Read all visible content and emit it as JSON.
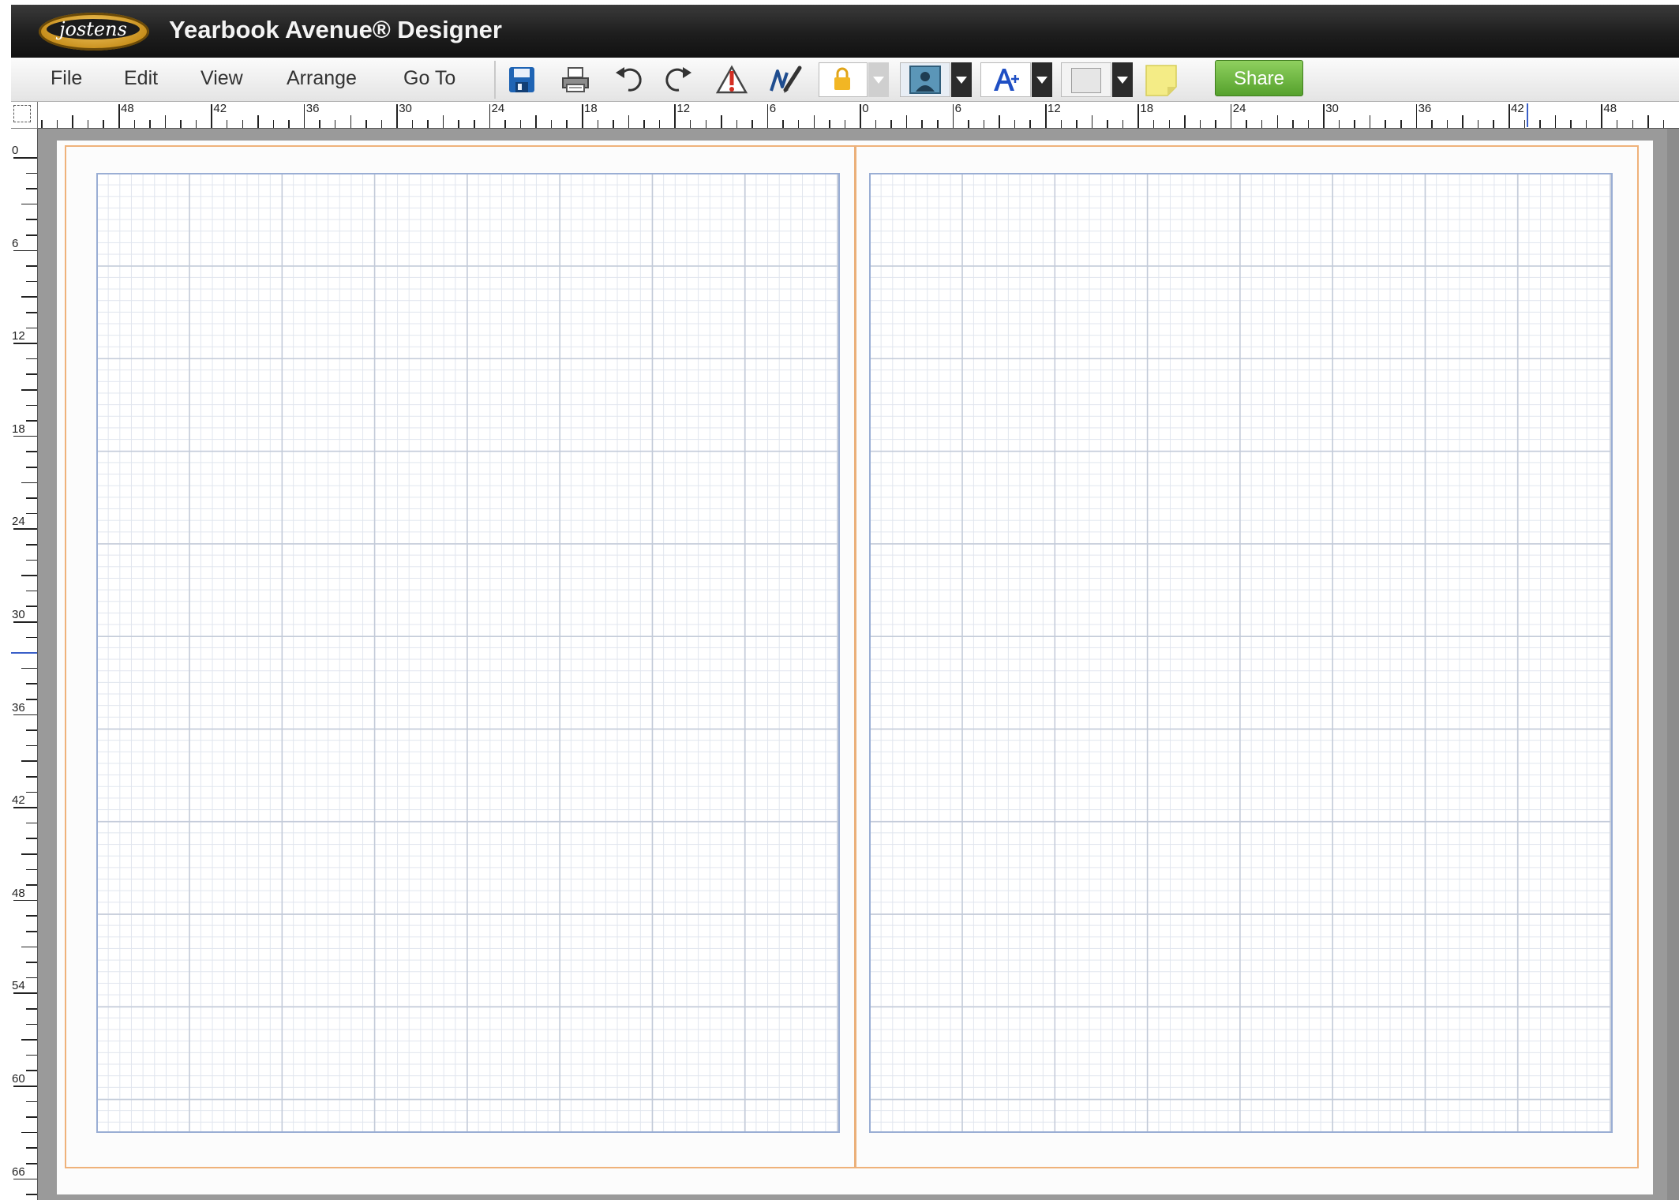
{
  "app": {
    "brand": "jostens",
    "title": "Yearbook Avenue® Designer"
  },
  "menu": [
    {
      "id": "file",
      "label": "File"
    },
    {
      "id": "edit",
      "label": "Edit"
    },
    {
      "id": "view",
      "label": "View"
    },
    {
      "id": "arrange",
      "label": "Arrange"
    },
    {
      "id": "goto",
      "label": "Go To"
    }
  ],
  "toolbar": {
    "tools": [
      {
        "id": "save",
        "icon": "save-icon"
      },
      {
        "id": "print",
        "icon": "print-icon"
      },
      {
        "id": "undo",
        "icon": "undo-icon"
      },
      {
        "id": "redo",
        "icon": "redo-icon"
      },
      {
        "id": "alert",
        "icon": "warning-icon"
      },
      {
        "id": "signature",
        "icon": "signature-pen-icon"
      },
      {
        "id": "lock",
        "icon": "lock-icon"
      },
      {
        "id": "image",
        "icon": "image-frame-icon"
      },
      {
        "id": "text",
        "icon": "text-tool-icon"
      },
      {
        "id": "shape",
        "icon": "blank-shape-icon"
      },
      {
        "id": "sticky",
        "icon": "sticky-note-icon"
      }
    ],
    "share_label": "Share"
  },
  "colors": {
    "accent": "#5aa532",
    "trim": "#efb27a",
    "grid": "#9aaed4",
    "titlebar": "#1e1e1e",
    "save_blue": "#1f64b4"
  },
  "rulers": {
    "horizontal_labels": [
      "48",
      "42",
      "36",
      "30",
      "24",
      "18",
      "12",
      "6",
      "0",
      "6",
      "12",
      "18",
      "24",
      "30",
      "36",
      "42",
      "48"
    ],
    "vertical_labels": [
      "0",
      "6",
      "12",
      "18",
      "24",
      "30",
      "36",
      "42",
      "48",
      "54",
      "60",
      "66"
    ]
  }
}
